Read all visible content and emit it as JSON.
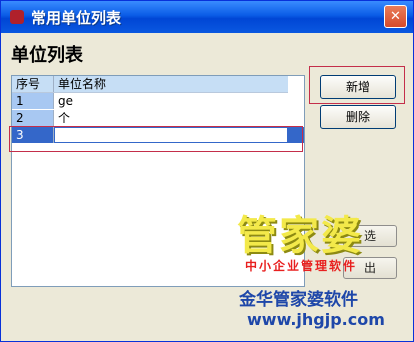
{
  "window": {
    "title": "常用单位列表"
  },
  "heading": "单位列表",
  "grid": {
    "columns": [
      "序号",
      "单位名称"
    ],
    "rows": [
      {
        "no": "1",
        "name": "ge"
      },
      {
        "no": "2",
        "name": "个"
      },
      {
        "no": "3",
        "name": ""
      }
    ]
  },
  "buttons": {
    "add": "新增",
    "delete": "删除",
    "select": "选",
    "close": "出"
  },
  "watermark": {
    "big": "管家婆",
    "small": "中小企业管理软件",
    "brand": "金华管家婆软件",
    "url": "www.jhgjp.com"
  },
  "icons": {
    "app": "app-icon",
    "close": "close-icon"
  }
}
